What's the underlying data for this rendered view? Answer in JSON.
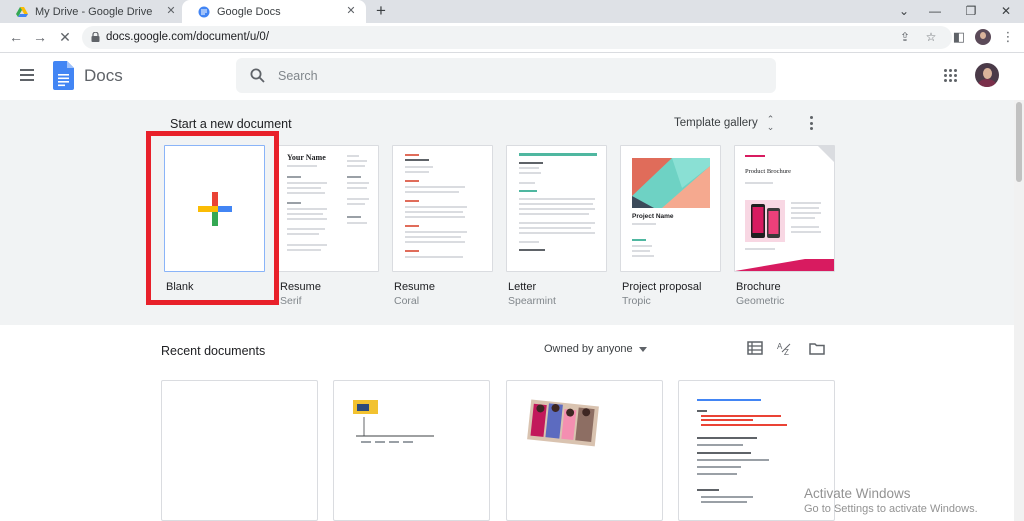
{
  "browser": {
    "tabs": [
      {
        "title": "My Drive - Google Drive",
        "active": false
      },
      {
        "title": "Google Docs",
        "active": true
      }
    ],
    "new_tab": "+",
    "url": "docs.google.com/document/u/0/"
  },
  "header": {
    "app_name": "Docs",
    "search_placeholder": "Search"
  },
  "templates": {
    "section_title": "Start a new document",
    "gallery_label": "Template gallery",
    "items": [
      {
        "name": "Blank",
        "subtitle": "",
        "highlighted": true
      },
      {
        "name": "Resume",
        "subtitle": "Serif",
        "preview_heading": "Your Name"
      },
      {
        "name": "Resume",
        "subtitle": "Coral"
      },
      {
        "name": "Letter",
        "subtitle": "Spearmint"
      },
      {
        "name": "Project proposal",
        "subtitle": "Tropic",
        "preview_heading": "Project Name"
      },
      {
        "name": "Brochure",
        "subtitle": "Geometric",
        "preview_heading": "Product Brochure"
      }
    ]
  },
  "recent": {
    "section_title": "Recent documents",
    "owner_filter": "Owned by anyone"
  },
  "watermark": {
    "title": "Activate Windows",
    "subtitle": "Go to Settings to activate Windows."
  },
  "colors": {
    "highlight": "#e8202a",
    "docs_blue": "#4285f4",
    "template_bg": "#f1f3f4",
    "coral": "#e06c5a",
    "spearmint": "#4fb7a0",
    "tropic_teal": "#6ed2c4",
    "brochure_pink": "#d81b60"
  }
}
